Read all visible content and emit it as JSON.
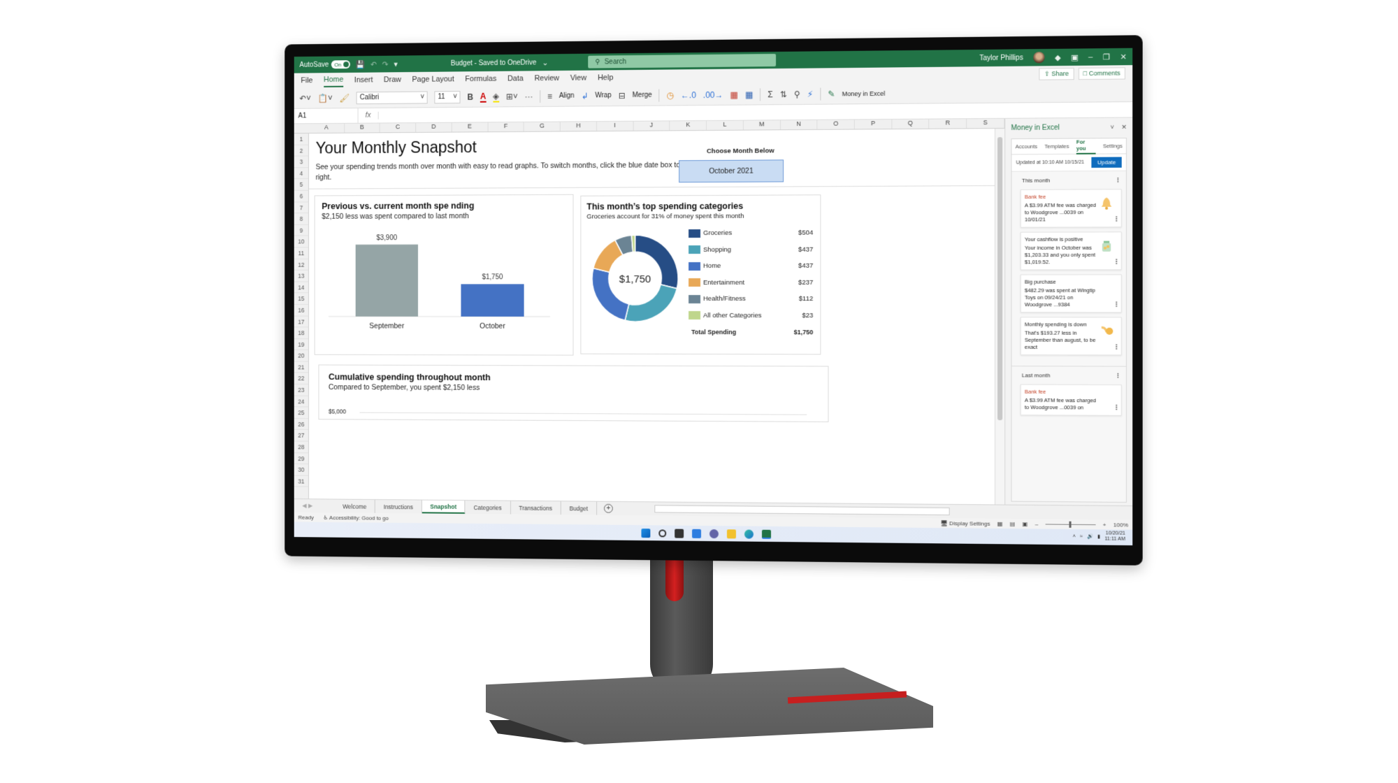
{
  "title_bar": {
    "autosave_label": "AutoSave",
    "autosave_state": "On",
    "document_title": "Budget - Saved to OneDrive",
    "search_placeholder": "Search",
    "user_name": "Taylor Phillips"
  },
  "menu": {
    "items": [
      "File",
      "Home",
      "Insert",
      "Draw",
      "Page Layout",
      "Formulas",
      "Data",
      "Review",
      "View",
      "Help"
    ],
    "active": "Home",
    "share_label": "Share",
    "comments_label": "Comments"
  },
  "ribbon": {
    "font_name": "Calibri",
    "font_size": "11",
    "bold_label": "B",
    "font_color_label": "A",
    "more_label": "···",
    "align_label": "Align",
    "wrap_label": "Wrap",
    "merge_label": "Merge",
    "money_in_excel_label": "Money in Excel"
  },
  "formula_bar": {
    "name_box": "A1",
    "fx_label": "fx",
    "formula": ""
  },
  "grid": {
    "columns": [
      "A",
      "B",
      "C",
      "D",
      "E",
      "F",
      "G",
      "H",
      "I",
      "J",
      "K",
      "L",
      "M",
      "N",
      "O",
      "P",
      "Q",
      "R",
      "S"
    ],
    "rows": [
      "1",
      "2",
      "3",
      "4",
      "5",
      "6",
      "7",
      "8",
      "9",
      "10",
      "11",
      "12",
      "13",
      "14",
      "15",
      "16",
      "17",
      "18",
      "19",
      "20",
      "21",
      "22",
      "23",
      "24",
      "25",
      "26",
      "27",
      "28",
      "29",
      "30",
      "31"
    ]
  },
  "snapshot": {
    "title": "Your Monthly Snapshot",
    "description": "See your spending trends month over month with easy to read graphs. To switch months, click the blue date box to the right.",
    "choose_label": "Choose Month Below",
    "selected_month": "October 2021"
  },
  "chart_data": [
    {
      "type": "bar",
      "title": "Previous vs. current month spe nding",
      "subtitle": "$2,150 less was spent compared to last month",
      "categories": [
        "September",
        "October"
      ],
      "values": [
        3900,
        1750
      ],
      "data_labels": [
        "$3,900",
        "$1,750"
      ],
      "colors": [
        "#95a5a6",
        "#4472c4"
      ],
      "ylim": [
        0,
        4300
      ],
      "grid": false
    },
    {
      "type": "pie",
      "variant": "donut",
      "title": "This month’s top spending categories",
      "subtitle": "Groceries account for 31% of money spent this month",
      "center_label": "$1,750",
      "categories": [
        "Groceries",
        "Shopping",
        "Home",
        "Entertainment",
        "Health/Fitness",
        "All other Categories"
      ],
      "values": [
        504,
        437,
        437,
        237,
        112,
        23
      ],
      "value_labels": [
        "$504",
        "$437",
        "$437",
        "$237",
        "$112",
        "$23"
      ],
      "colors": [
        "#264d85",
        "#4ba3b8",
        "#4472c4",
        "#e8a857",
        "#6b8494",
        "#bfd68c"
      ],
      "total_label": "Total Spending",
      "total_value": "$1,750",
      "legend": "right"
    },
    {
      "type": "line",
      "title": "Cumulative spending throughout month",
      "subtitle": "Compared to September, you spent $2,150 less",
      "y_tick_labels": [
        "$5,000"
      ]
    }
  ],
  "side_pane": {
    "title": "Money in Excel",
    "tabs": [
      "Accounts",
      "Templates",
      "For you",
      "Settings"
    ],
    "active_tab": "For you",
    "updated_text": "Updated at 10:10 AM 10/15/21",
    "update_button": "Update",
    "sections": [
      {
        "title": "This month",
        "cards": [
          {
            "title": "Bank fee",
            "body": "A $3.99 ATM fee was charged to Woodgrove ...0039 on 10/01/21",
            "icon": "bell-icon",
            "style": "fee"
          },
          {
            "title": "Your cashflow is positive",
            "body": "Your income in October was $1,203.33 and you only spent $1,019.52.",
            "icon": "coin-jar-icon",
            "style": "normal"
          },
          {
            "title": "Big purchase",
            "body": "$482.29 was spent at Wingtip Toys on 09/24/21 on Woodgrove ...9384",
            "icon": "",
            "style": "normal"
          },
          {
            "title": "Monthly spending is down",
            "body": "That's $193.27 less in September than august, to be exact",
            "icon": "coin-down-icon",
            "style": "normal"
          }
        ]
      },
      {
        "title": "Last month",
        "cards": [
          {
            "title": "Bank fee",
            "body": "A $3.99 ATM fee was charged to Woodgrove ...0039 on",
            "icon": "",
            "style": "fee"
          }
        ]
      }
    ]
  },
  "sheet_tabs": {
    "tabs": [
      "Welcome",
      "Instructions",
      "Snapshot",
      "Categories",
      "Transactions",
      "Budget"
    ],
    "active": "Snapshot"
  },
  "status_bar": {
    "ready": "Ready",
    "accessibility": "Accessibility: Good to go",
    "display_settings": "Display Settings",
    "zoom_level": "100%",
    "zoom_minus": "–",
    "zoom_plus": "+"
  },
  "taskbar": {
    "date": "10/20/21",
    "time": "11:11 AM",
    "apps": [
      "start-icon",
      "search-icon",
      "task-view-icon",
      "widgets-icon",
      "teams-chat-icon",
      "file-explorer-icon",
      "edge-icon",
      "excel-icon"
    ]
  },
  "colors": {
    "excel_green": "#217346",
    "accent_blue": "#4472c4",
    "update_blue": "#0f6cbd",
    "fee_red": "#c4452a",
    "month_box": "#c9dcf3"
  }
}
